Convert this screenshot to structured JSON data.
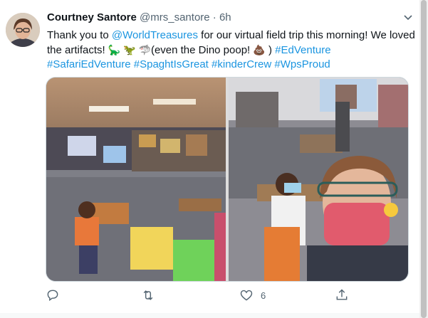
{
  "author": {
    "name": "Courtney Santore",
    "handle": "@mrs_santore",
    "separator": "·",
    "time": "6h"
  },
  "tweet": {
    "part1": "Thank you to ",
    "mention": "@WorldTreasures",
    "part2": " for our virtual field trip this morning! We loved the artifacts! ",
    "emojis1": "🦕 🦖 🦈",
    "part3": "(even the Dino poop! ",
    "emoji2": "💩",
    "part4": " ) ",
    "hashtags": [
      "#EdVenture",
      "#SafariEdVenture",
      "#SpaghtIsGreat",
      "#kinderCrew",
      "#WpsProud"
    ]
  },
  "actions": {
    "reply_icon": "reply-icon",
    "retweet_icon": "retweet-icon",
    "like_icon": "heart-icon",
    "like_count": "6",
    "share_icon": "share-icon"
  },
  "colors": {
    "link": "#1b95e0",
    "secondary_text": "#536471"
  }
}
